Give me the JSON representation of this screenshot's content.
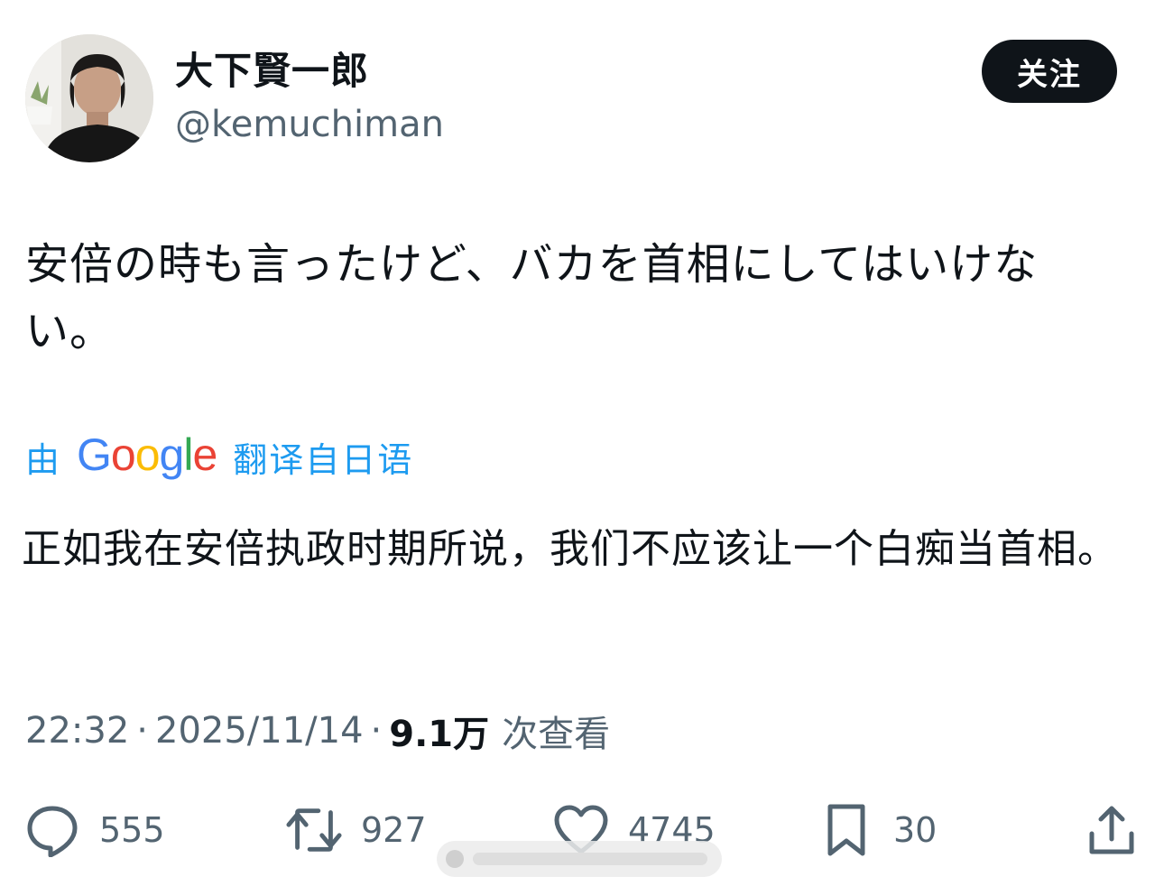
{
  "author": {
    "display_name": "大下賢一郎",
    "handle": "@kemuchiman",
    "avatar_icon": "profile-photo"
  },
  "follow_button": {
    "label": "关注"
  },
  "tweet": {
    "text": "安倍の時も言ったけど、バカを首相にしてはいけない。"
  },
  "translation": {
    "by_label": "由",
    "provider": "Google",
    "from_label": "翻译自日语",
    "text": "正如我在安倍执政时期所说，我们不应该让一个白痴当首相。"
  },
  "meta": {
    "time": "22:32",
    "separator": "·",
    "date": "2025/11/14",
    "views_count": "9.1万",
    "views_label": "次查看"
  },
  "actions": {
    "reply": {
      "icon": "reply-icon",
      "count": "555"
    },
    "repost": {
      "icon": "repost-icon",
      "count": "927"
    },
    "like": {
      "icon": "heart-icon",
      "count": "4745"
    },
    "bookmark": {
      "icon": "bookmark-icon",
      "count": "30"
    },
    "share": {
      "icon": "share-icon"
    }
  },
  "colors": {
    "text_primary": "#0f1419",
    "text_secondary": "#536471",
    "link_blue": "#1d9bf0",
    "button_bg": "#0f1419",
    "google_blue": "#4285F4",
    "google_red": "#EA4335",
    "google_yellow": "#FBBC05",
    "google_green": "#34A853"
  }
}
